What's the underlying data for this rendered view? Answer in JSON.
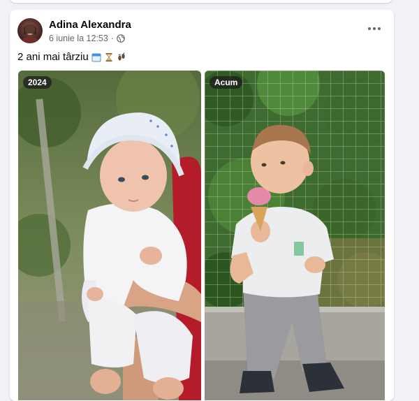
{
  "post": {
    "author": "Adina Alexandra",
    "date": "6 iunie la 12:53",
    "separator": "·",
    "privacy_icon": "globe-icon",
    "caption": "2 ani mai târziu",
    "caption_emojis": [
      "calendar-icon",
      "hourglass-icon",
      "footprints-icon"
    ],
    "photos": [
      {
        "tag": "2024"
      },
      {
        "tag": "Acum"
      }
    ]
  },
  "colors": {
    "text_primary": "#050505",
    "text_secondary": "#65676b",
    "card_bg": "#ffffff",
    "page_bg": "#f0f2f5"
  }
}
